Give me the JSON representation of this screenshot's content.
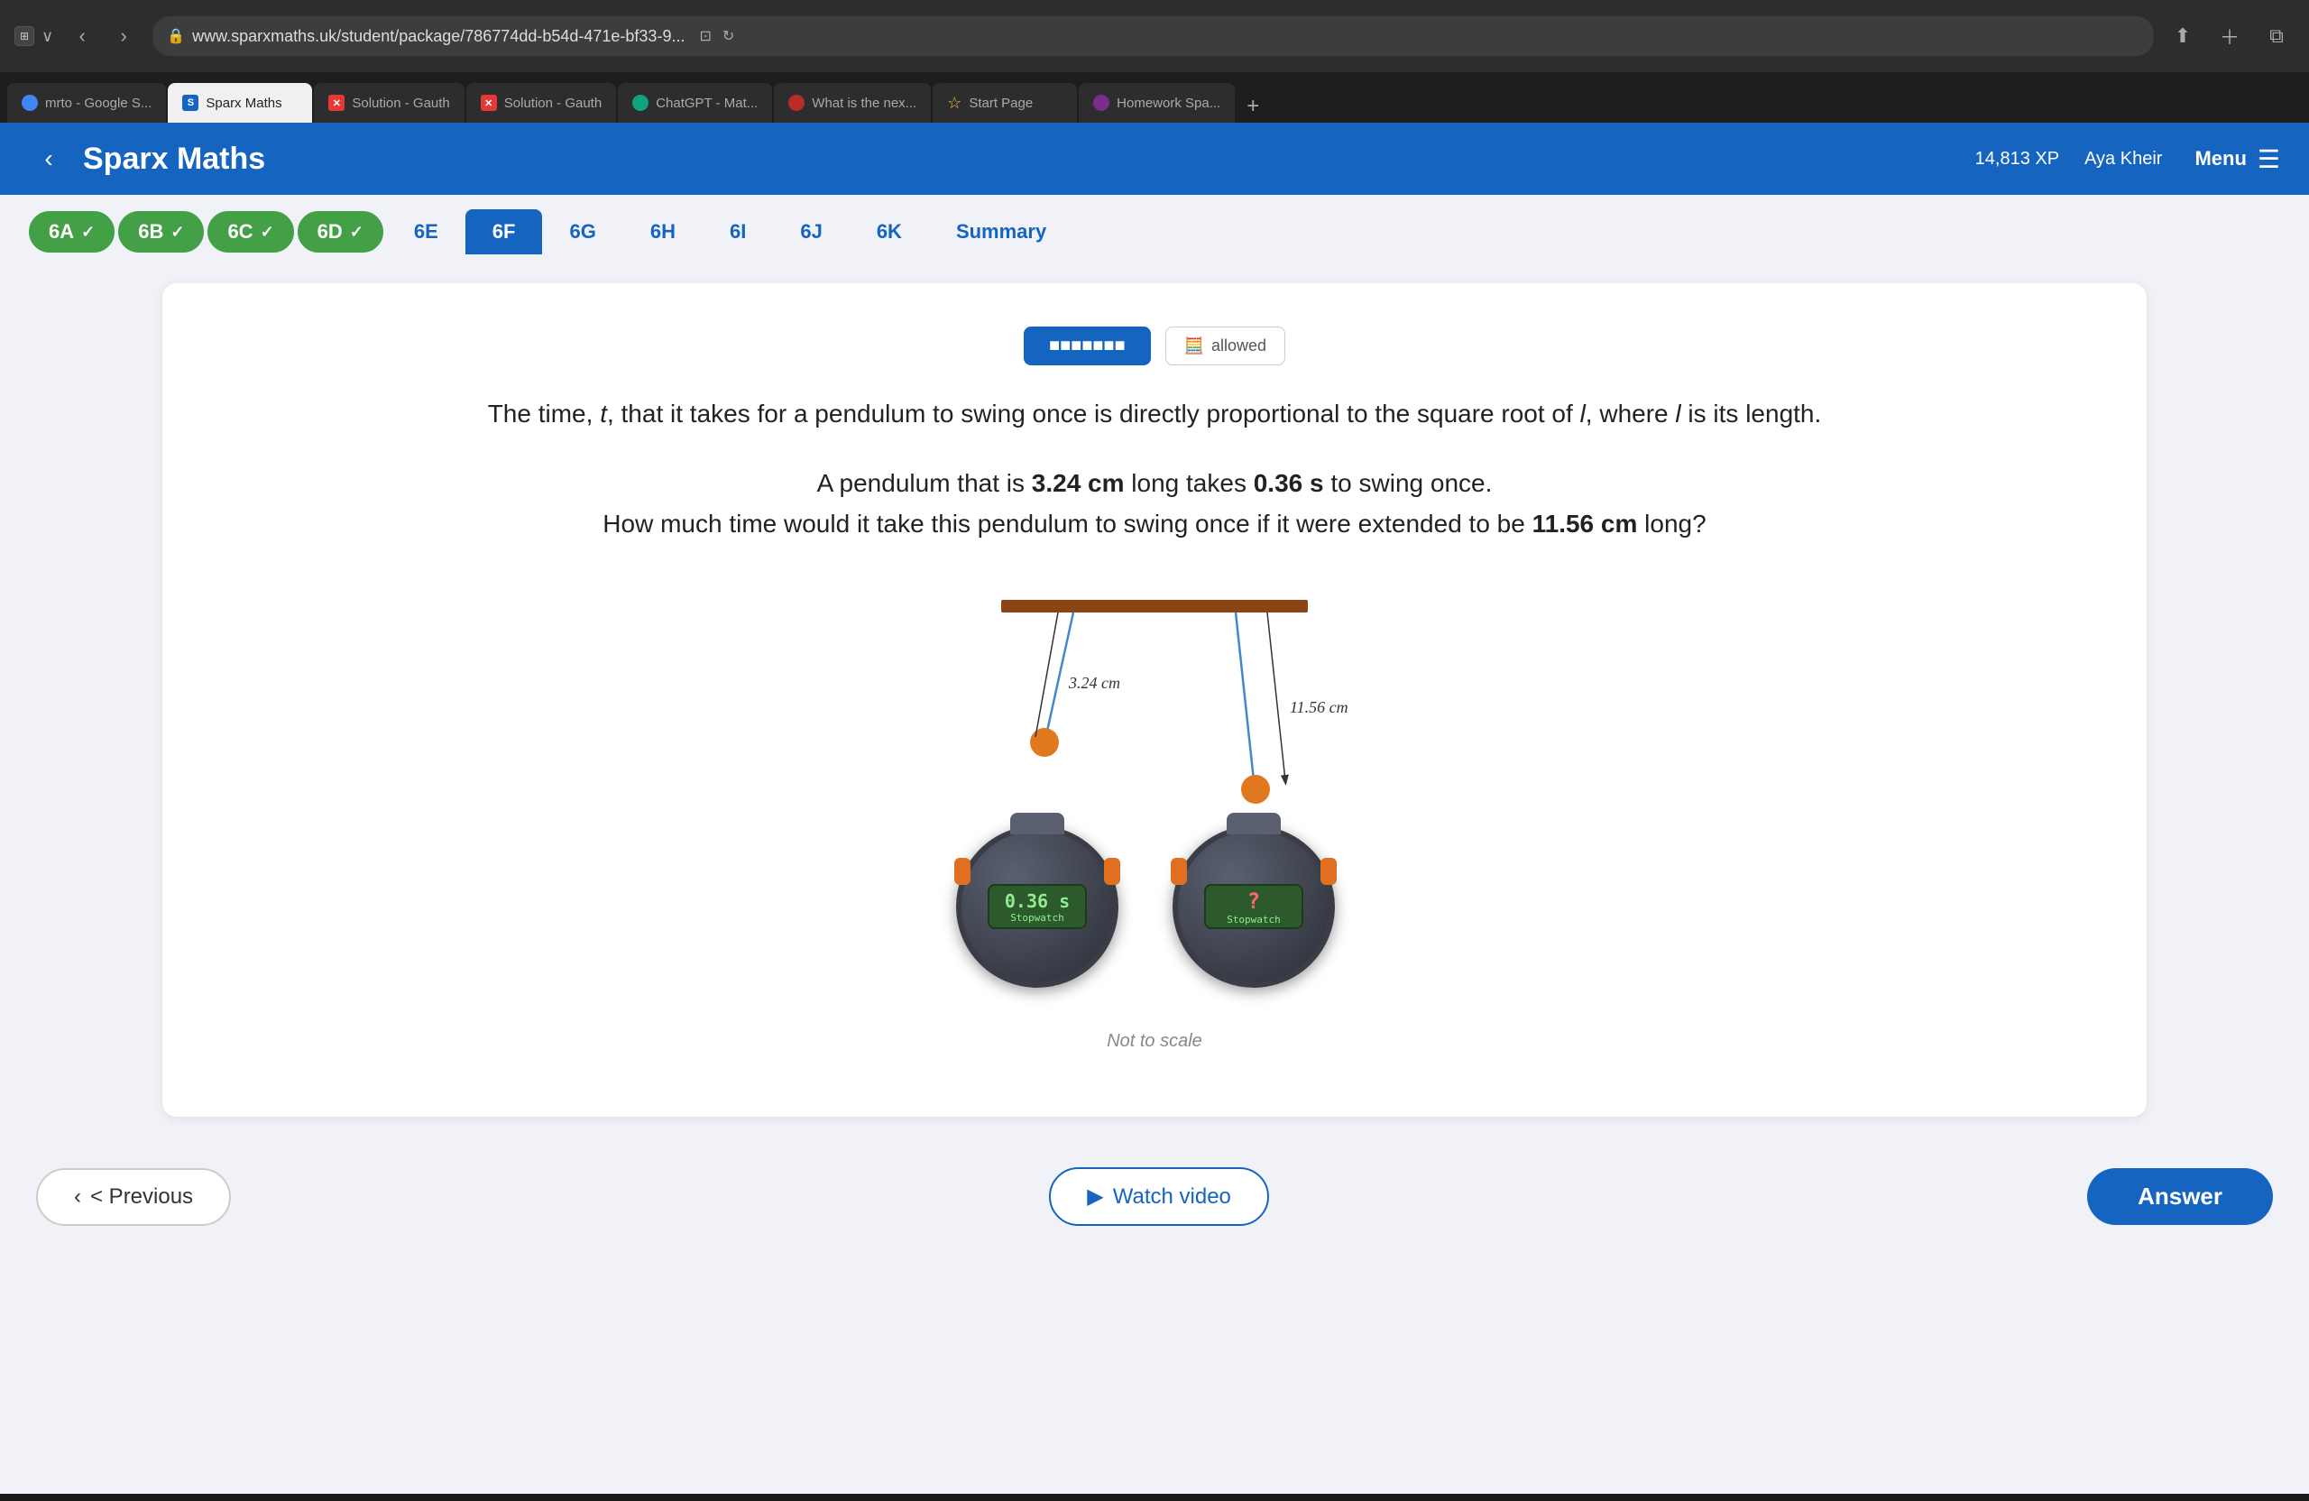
{
  "browser": {
    "url": "www.sparxmaths.uk/student/package/786774dd-b54d-471e-bf33-9...",
    "tabs": [
      {
        "label": "mrto - Google S...",
        "favicon_type": "google",
        "active": false
      },
      {
        "label": "Sparx Maths",
        "favicon_type": "sparx",
        "active": true
      },
      {
        "label": "Solution - Gauth",
        "favicon_type": "solution",
        "active": false
      },
      {
        "label": "Solution - Gauth",
        "favicon_type": "solution",
        "active": false
      },
      {
        "label": "ChatGPT - Mat...",
        "favicon_type": "chatgpt",
        "active": false
      },
      {
        "label": "What is the nex...",
        "favicon_type": "quora",
        "active": false
      },
      {
        "label": "Start Page",
        "favicon_type": "star",
        "active": false
      },
      {
        "label": "Homework Spa...",
        "favicon_type": "homework",
        "active": false
      }
    ]
  },
  "header": {
    "title": "Sparx Maths",
    "xp": "14,813 XP",
    "user": "Aya Kheir",
    "menu": "Menu"
  },
  "section_tabs": [
    {
      "label": "6A",
      "state": "completed"
    },
    {
      "label": "6B",
      "state": "completed"
    },
    {
      "label": "6C",
      "state": "completed"
    },
    {
      "label": "6D",
      "state": "completed"
    },
    {
      "label": "6E",
      "state": "inactive"
    },
    {
      "label": "6F",
      "state": "active"
    },
    {
      "label": "6G",
      "state": "inactive"
    },
    {
      "label": "6H",
      "state": "inactive"
    },
    {
      "label": "6I",
      "state": "inactive"
    },
    {
      "label": "6J",
      "state": "inactive"
    },
    {
      "label": "6K",
      "state": "inactive"
    },
    {
      "label": "Summary",
      "state": "summary"
    }
  ],
  "question": {
    "intro": "The time, t, that it takes for a pendulum to swing once is directly proportional to the square root of l, where l is its length.",
    "body": "A pendulum that is 3.24 cm long takes 0.36 s to swing once.",
    "sub": "How much time would it take this pendulum to swing once if it were extended to be 11.56 cm long?",
    "length1": "3.24 cm",
    "length2": "11.56 cm",
    "time1": "0.36 s",
    "stopwatch1_display": "0.36 s",
    "stopwatch1_label": "Stopwatch",
    "stopwatch2_display": "?",
    "stopwatch2_label": "Stopwatch",
    "not_to_scale": "Not to scale"
  },
  "allowed": {
    "label": "allowed"
  },
  "buttons": {
    "previous": "< Previous",
    "watch_video": "Watch video",
    "answer": "Answer"
  }
}
